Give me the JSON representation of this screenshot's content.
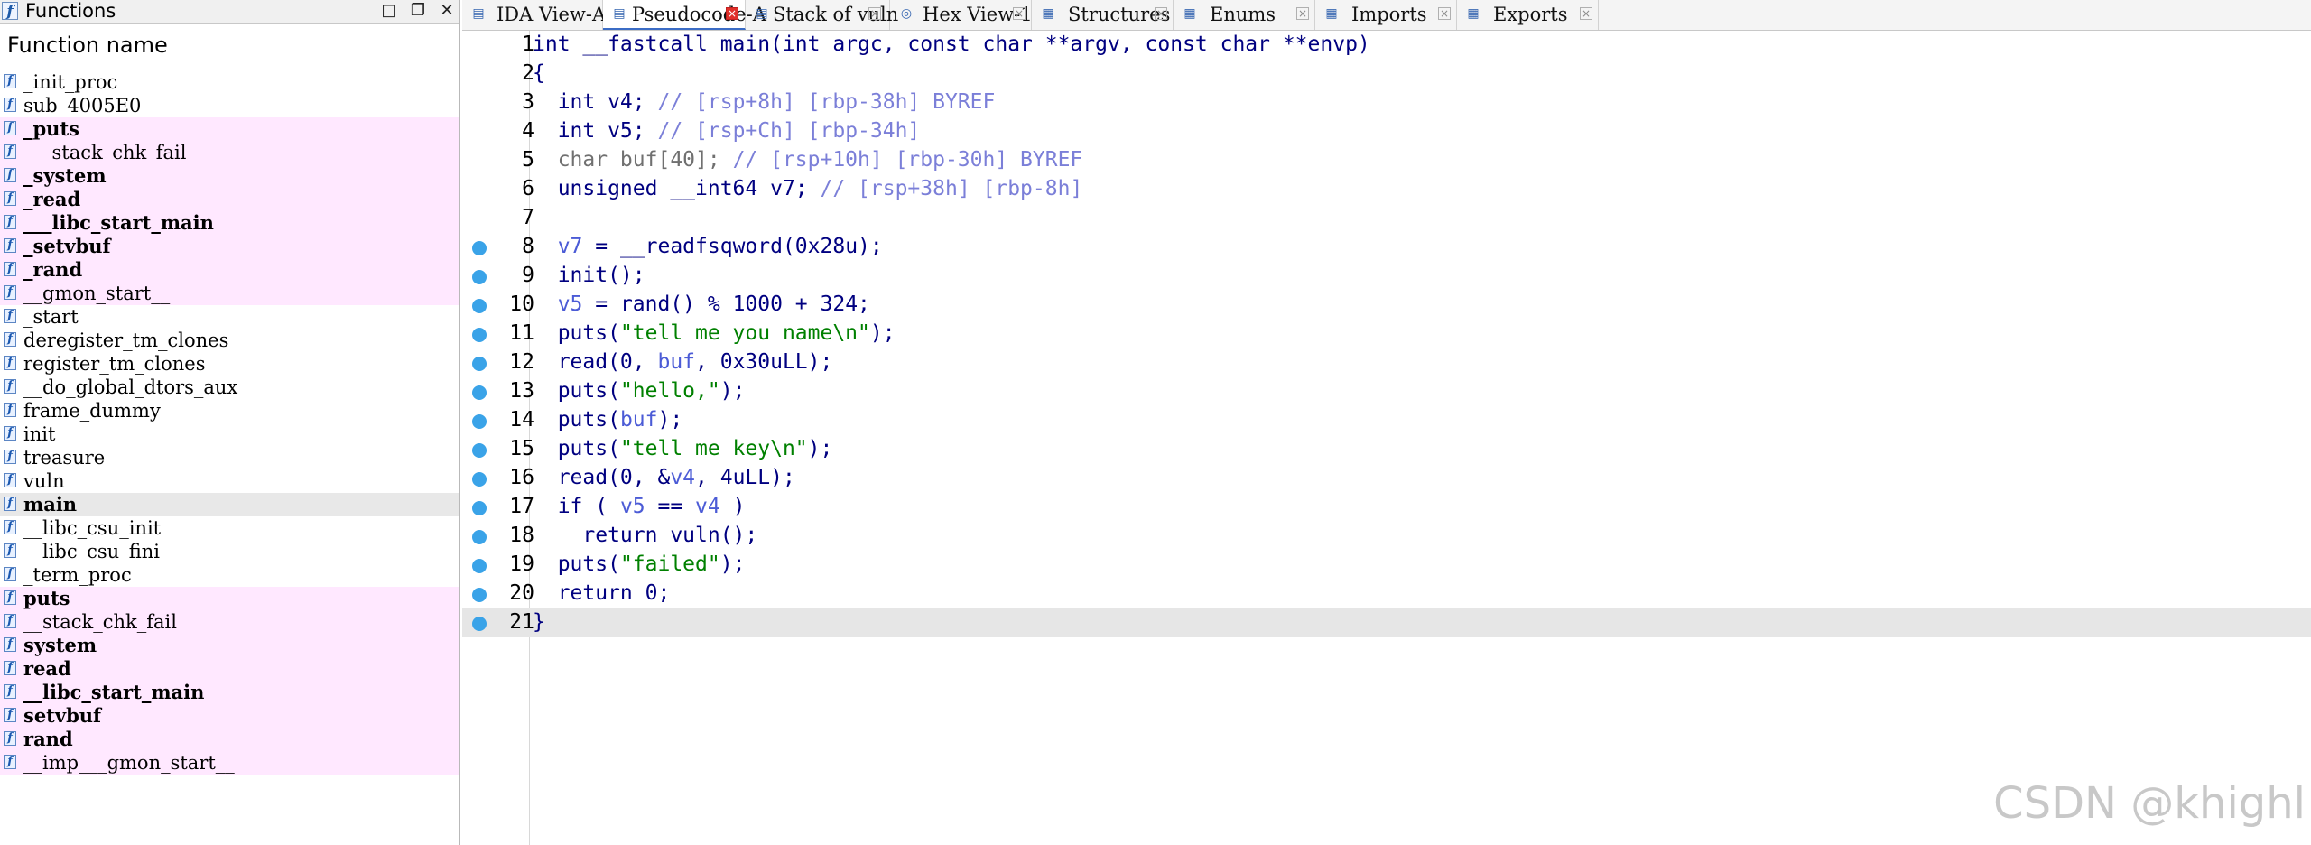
{
  "functions_panel": {
    "title": "Functions",
    "title_icon": "function-icon",
    "column_header": "Function name",
    "buttons": [
      "maximize-icon",
      "restore-icon",
      "close-icon"
    ],
    "functions": [
      {
        "name": "_init_proc",
        "style": "normal",
        "bg": "white"
      },
      {
        "name": "sub_4005E0",
        "style": "normal",
        "bg": "white"
      },
      {
        "name": "_puts",
        "style": "bold",
        "bg": "pink"
      },
      {
        "name": "___stack_chk_fail",
        "style": "normal",
        "bg": "pink"
      },
      {
        "name": "_system",
        "style": "bold",
        "bg": "pink"
      },
      {
        "name": "_read",
        "style": "bold",
        "bg": "pink"
      },
      {
        "name": "___libc_start_main",
        "style": "bold",
        "bg": "pink"
      },
      {
        "name": "_setvbuf",
        "style": "bold",
        "bg": "pink"
      },
      {
        "name": "_rand",
        "style": "bold",
        "bg": "pink"
      },
      {
        "name": "__gmon_start__",
        "style": "normal",
        "bg": "pink"
      },
      {
        "name": "_start",
        "style": "normal",
        "bg": "white"
      },
      {
        "name": "deregister_tm_clones",
        "style": "normal",
        "bg": "white"
      },
      {
        "name": "register_tm_clones",
        "style": "normal",
        "bg": "white"
      },
      {
        "name": "__do_global_dtors_aux",
        "style": "normal",
        "bg": "white"
      },
      {
        "name": "frame_dummy",
        "style": "normal",
        "bg": "white"
      },
      {
        "name": "init",
        "style": "normal",
        "bg": "white"
      },
      {
        "name": "treasure",
        "style": "normal",
        "bg": "white"
      },
      {
        "name": "vuln",
        "style": "normal",
        "bg": "white"
      },
      {
        "name": "main",
        "style": "bold",
        "bg": "selected"
      },
      {
        "name": "__libc_csu_init",
        "style": "normal",
        "bg": "white"
      },
      {
        "name": "__libc_csu_fini",
        "style": "normal",
        "bg": "white"
      },
      {
        "name": "_term_proc",
        "style": "normal",
        "bg": "white"
      },
      {
        "name": "puts",
        "style": "bold",
        "bg": "pink"
      },
      {
        "name": "__stack_chk_fail",
        "style": "normal",
        "bg": "pink"
      },
      {
        "name": "system",
        "style": "bold",
        "bg": "pink"
      },
      {
        "name": "read",
        "style": "bold",
        "bg": "pink"
      },
      {
        "name": "__libc_start_main",
        "style": "bold",
        "bg": "pink"
      },
      {
        "name": "setvbuf",
        "style": "bold",
        "bg": "pink"
      },
      {
        "name": "rand",
        "style": "bold",
        "bg": "pink"
      },
      {
        "name": "__imp___gmon_start__",
        "style": "normal",
        "bg": "pink"
      }
    ]
  },
  "tabs": [
    {
      "label": "IDA View-A",
      "icon": "ida-view-icon",
      "active": false
    },
    {
      "label": "Pseudocode-A",
      "icon": "pseudocode-icon",
      "active": true
    },
    {
      "label": "Stack of vuln",
      "icon": "stack-icon",
      "active": false
    },
    {
      "label": "Hex View-1",
      "icon": "hex-view-icon",
      "active": false
    },
    {
      "label": "Structures",
      "icon": "structures-icon",
      "active": false
    },
    {
      "label": "Enums",
      "icon": "enums-icon",
      "active": false
    },
    {
      "label": "Imports",
      "icon": "imports-icon",
      "active": false
    },
    {
      "label": "Exports",
      "icon": "exports-icon",
      "active": false
    }
  ],
  "code": {
    "current_line": 21,
    "lines": [
      {
        "num": "1",
        "bp": false,
        "tokens": [
          [
            "p",
            "int __fastcall main(int argc, const char **argv, const char **envp)"
          ]
        ]
      },
      {
        "num": "2",
        "bp": false,
        "tokens": [
          [
            "p",
            "{"
          ]
        ]
      },
      {
        "num": "3",
        "bp": false,
        "tokens": [
          [
            "p",
            "  int v4; "
          ],
          [
            "c",
            "// [rsp+8h] [rbp-38h] BYREF"
          ]
        ]
      },
      {
        "num": "4",
        "bp": false,
        "tokens": [
          [
            "p",
            "  int v5; "
          ],
          [
            "c",
            "// [rsp+Ch] [rbp-34h]"
          ]
        ]
      },
      {
        "num": "5",
        "bp": false,
        "tokens": [
          [
            "g",
            "  char buf[40]; "
          ],
          [
            "c",
            "// [rsp+10h] [rbp-30h] BYREF"
          ]
        ]
      },
      {
        "num": "6",
        "bp": false,
        "tokens": [
          [
            "p",
            "  unsigned __int64 v7; "
          ],
          [
            "c",
            "// [rsp+38h] [rbp-8h]"
          ]
        ]
      },
      {
        "num": "7",
        "bp": false,
        "tokens": [
          [
            "p",
            ""
          ]
        ]
      },
      {
        "num": "8",
        "bp": true,
        "tokens": [
          [
            "p",
            "  "
          ],
          [
            "v",
            "v7"
          ],
          [
            "p",
            " = __readfsqword(0x28u);"
          ]
        ]
      },
      {
        "num": "9",
        "bp": true,
        "tokens": [
          [
            "p",
            "  init();"
          ]
        ]
      },
      {
        "num": "10",
        "bp": true,
        "tokens": [
          [
            "p",
            "  "
          ],
          [
            "v",
            "v5"
          ],
          [
            "p",
            " = rand() % 1000 + 324;"
          ]
        ]
      },
      {
        "num": "11",
        "bp": true,
        "tokens": [
          [
            "p",
            "  puts("
          ],
          [
            "s",
            "\"tell me you name\\n\""
          ],
          [
            "p",
            ");"
          ]
        ]
      },
      {
        "num": "12",
        "bp": true,
        "tokens": [
          [
            "p",
            "  read(0, "
          ],
          [
            "v",
            "buf"
          ],
          [
            "p",
            ", 0x30uLL);"
          ]
        ]
      },
      {
        "num": "13",
        "bp": true,
        "tokens": [
          [
            "p",
            "  puts("
          ],
          [
            "s",
            "\"hello,\""
          ],
          [
            "p",
            ");"
          ]
        ]
      },
      {
        "num": "14",
        "bp": true,
        "tokens": [
          [
            "p",
            "  puts("
          ],
          [
            "v",
            "buf"
          ],
          [
            "p",
            ");"
          ]
        ]
      },
      {
        "num": "15",
        "bp": true,
        "tokens": [
          [
            "p",
            "  puts("
          ],
          [
            "s",
            "\"tell me key\\n\""
          ],
          [
            "p",
            ");"
          ]
        ]
      },
      {
        "num": "16",
        "bp": true,
        "tokens": [
          [
            "p",
            "  read(0, &"
          ],
          [
            "v",
            "v4"
          ],
          [
            "p",
            ", 4uLL);"
          ]
        ]
      },
      {
        "num": "17",
        "bp": true,
        "tokens": [
          [
            "p",
            "  if ( "
          ],
          [
            "v",
            "v5"
          ],
          [
            "p",
            " == "
          ],
          [
            "v",
            "v4"
          ],
          [
            "p",
            " )"
          ]
        ]
      },
      {
        "num": "18",
        "bp": true,
        "tokens": [
          [
            "p",
            "    return vuln();"
          ]
        ]
      },
      {
        "num": "19",
        "bp": true,
        "tokens": [
          [
            "p",
            "  puts("
          ],
          [
            "s",
            "\"failed\""
          ],
          [
            "p",
            ");"
          ]
        ]
      },
      {
        "num": "20",
        "bp": true,
        "tokens": [
          [
            "p",
            "  return 0;"
          ]
        ]
      },
      {
        "num": "21",
        "bp": true,
        "tokens": [
          [
            "p",
            "}"
          ]
        ]
      }
    ]
  },
  "watermark": "CSDN @khighl",
  "colors": {
    "plain": "#000080",
    "variable": "#4b5bd6",
    "comment": "#7b7fd8",
    "string": "#008000",
    "import_row_bg": "#ffe8ff",
    "breakpoint_dot": "#3aa3e8"
  }
}
